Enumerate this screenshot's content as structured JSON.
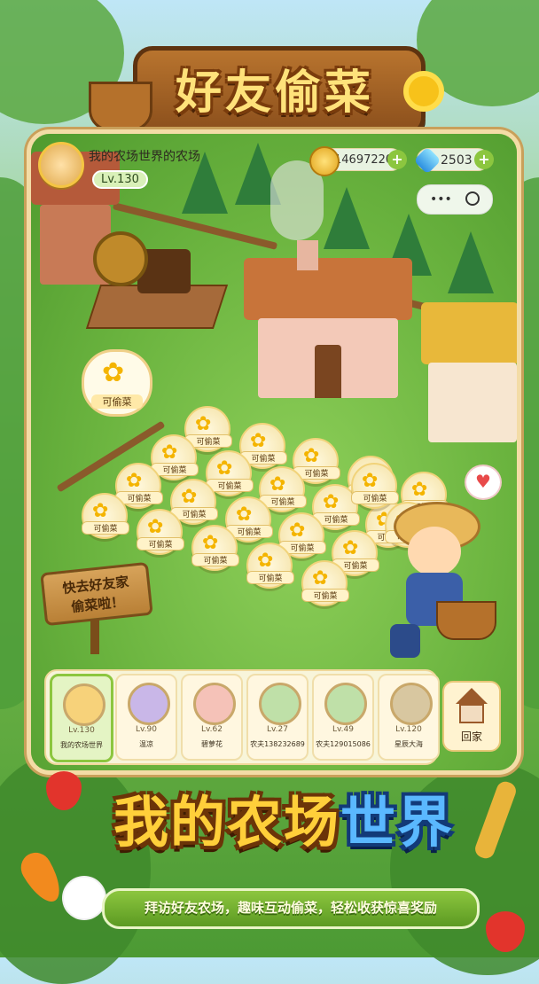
{
  "title": "好友偷菜",
  "hud": {
    "farm_name": "我的农场世界的农场",
    "level": "Lv.130",
    "coins": "14697220",
    "diamonds": "2503",
    "coin_icon": "coin-icon",
    "diamond_icon": "diamond-icon"
  },
  "plots": {
    "steal_label": "可偷菜",
    "count": 22
  },
  "bubble_label": "可偷菜",
  "sign_text": [
    "快去好友家",
    "偷菜啦！"
  ],
  "friends": [
    {
      "level": "Lv.130",
      "name": "我的农场世界"
    },
    {
      "level": "Lv.90",
      "name": "温凉"
    },
    {
      "level": "Lv.62",
      "name": "碧萝花"
    },
    {
      "level": "Lv.27",
      "name": "农夫138232689"
    },
    {
      "level": "Lv.49",
      "name": "农夫129015086"
    },
    {
      "level": "Lv.120",
      "name": "星辰大海"
    }
  ],
  "home_button": "回家",
  "big_title": {
    "part1": "我的农场",
    "part2": "世界"
  },
  "subtitle": "拜访好友农场，趣味互动偷菜，轻松收获惊喜奖励",
  "colors": {
    "accent_green": "#8cc63f",
    "gold": "#ffcf3a",
    "blue": "#5ab8ff",
    "wood": "#8b4f1c"
  }
}
